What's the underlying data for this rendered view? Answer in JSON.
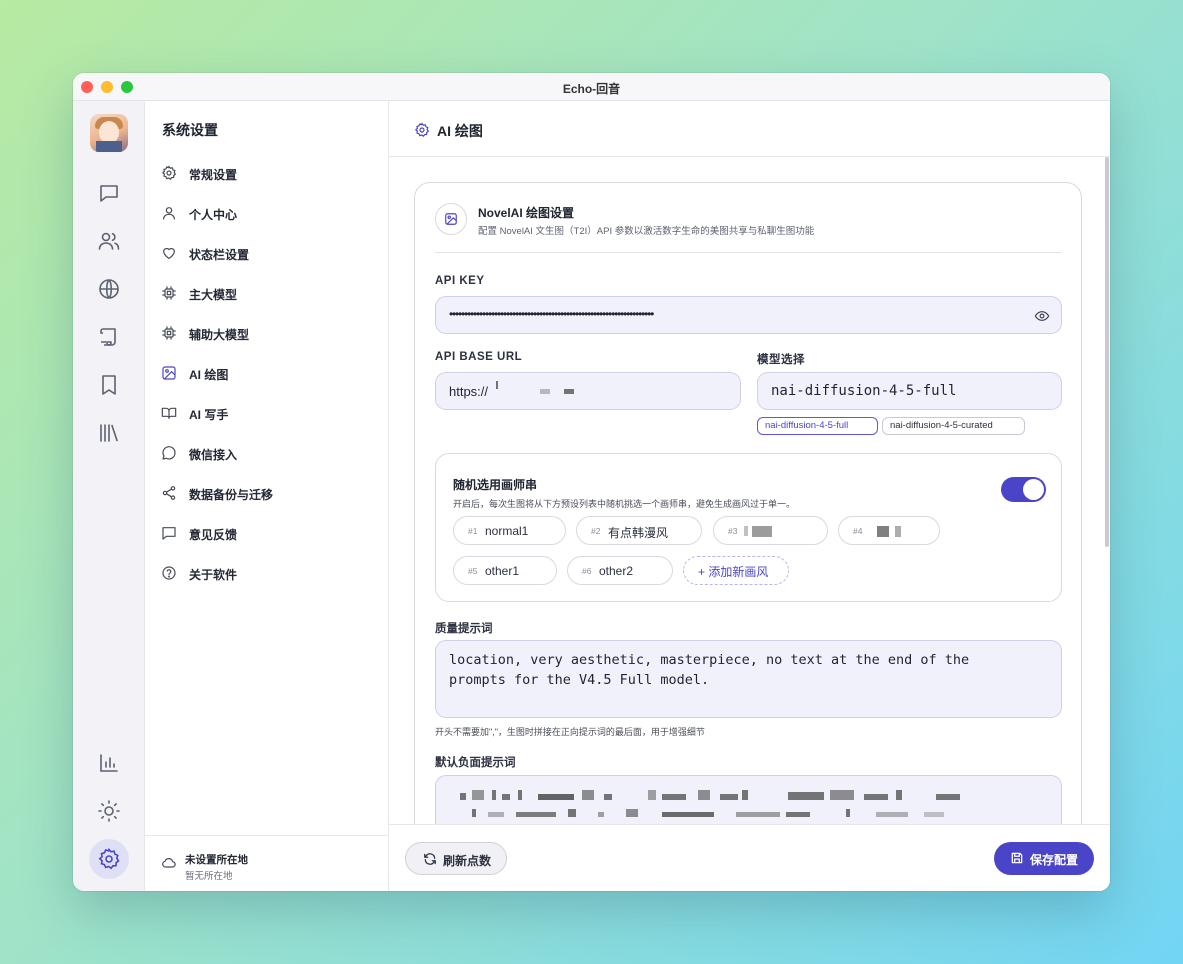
{
  "window": {
    "title": "Echo-回音"
  },
  "colors": {
    "accent": "#4a45c8",
    "field_bg": "#f1f1fb",
    "field_border": "#cfd0e6"
  },
  "rail": {
    "items": [
      {
        "icon": "chat-icon"
      },
      {
        "icon": "users-icon"
      },
      {
        "icon": "globe-icon"
      },
      {
        "icon": "scroll-icon"
      },
      {
        "icon": "bookmark-icon"
      },
      {
        "icon": "library-icon"
      },
      {
        "icon": "bar-chart-icon"
      },
      {
        "icon": "sun-icon"
      },
      {
        "icon": "gear-icon",
        "active": true
      }
    ]
  },
  "sidebar": {
    "title": "系统设置",
    "items": [
      {
        "label": "常规设置",
        "icon": "gear-icon"
      },
      {
        "label": "个人中心",
        "icon": "user-icon"
      },
      {
        "label": "状态栏设置",
        "icon": "heart-icon"
      },
      {
        "label": "主大模型",
        "icon": "chip-icon"
      },
      {
        "label": "辅助大模型",
        "icon": "chip-icon"
      },
      {
        "label": "AI 绘图",
        "icon": "image-icon",
        "active": true
      },
      {
        "label": "AI 写手",
        "icon": "book-icon"
      },
      {
        "label": "微信接入",
        "icon": "message-circle-icon"
      },
      {
        "label": "数据备份与迁移",
        "icon": "share-icon"
      },
      {
        "label": "意见反馈",
        "icon": "message-square-icon"
      },
      {
        "label": "关于软件",
        "icon": "help-circle-icon"
      }
    ],
    "footer": {
      "title": "未设置所在地",
      "subtitle": "暂无所在地",
      "icon": "cloud-icon"
    }
  },
  "header": {
    "title": "AI 绘图",
    "icon": "gear-icon"
  },
  "card": {
    "title": "NovelAI 绘图设置",
    "subtitle": "配置 NovelAI 文生图（T2I）API 参数以激活数字生命的美图共享与私聊生图功能",
    "api_key": {
      "label": "API KEY",
      "value": "••••••••••••••••••••••••••••••••••••••••••••••••••••••••••••••••••••"
    },
    "base_url": {
      "label": "API BASE URL",
      "value": "https://"
    },
    "model": {
      "label": "模型选择",
      "value": "nai-diffusion-4-5-full",
      "options": [
        "nai-diffusion-4-5-full",
        "nai-diffusion-4-5-curated"
      ],
      "selected_index": 0
    },
    "random_artist": {
      "title": "随机选用画师串",
      "description": "开启后，每次生图将从下方预设列表中随机挑选一个画师串，避免生成画风过于单一。",
      "enabled": true,
      "presets": [
        {
          "num": "#1",
          "name": "normal1"
        },
        {
          "num": "#2",
          "name": "有点韩漫风"
        },
        {
          "num": "#3",
          "name": ""
        },
        {
          "num": "#4",
          "name": ""
        },
        {
          "num": "#5",
          "name": "other1"
        },
        {
          "num": "#6",
          "name": "other2"
        }
      ],
      "add_label": "+ 添加新画风"
    },
    "quality": {
      "label": "质量提示词",
      "value": "location, very aesthetic, masterpiece, no text at the end of the prompts for the V4.5 Full model.",
      "hint": "开头不需要加\",\"，生图时拼接在正向提示词的最后面，用于增强细节"
    },
    "negative": {
      "label": "默认负面提示词"
    }
  },
  "footer": {
    "refresh_label": "刷新点数",
    "save_label": "保存配置"
  }
}
